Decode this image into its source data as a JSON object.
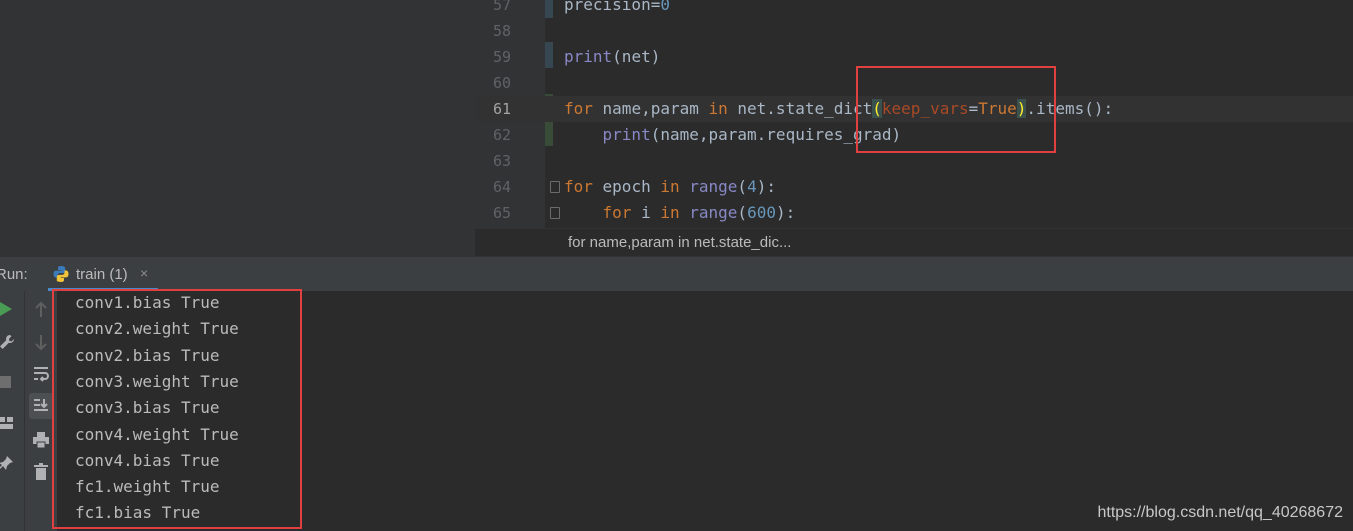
{
  "editor": {
    "lines": [
      {
        "number": "57",
        "tokens": [
          {
            "t": "precision"
          },
          {
            "t": "=",
            "c": "plain"
          },
          {
            "t": "0",
            "c": "num"
          }
        ]
      },
      {
        "number": "58",
        "tokens": []
      },
      {
        "number": "59",
        "tokens": [
          {
            "t": "print",
            "c": "bi"
          },
          {
            "t": "(net)"
          }
        ]
      },
      {
        "number": "60",
        "tokens": []
      },
      {
        "number": "61",
        "tokens": [
          {
            "t": "for",
            "c": "kw"
          },
          {
            "t": " name,param "
          },
          {
            "t": "in",
            "c": "kw"
          },
          {
            "t": " net.state_dict"
          },
          {
            "t": "(",
            "c": "paren-match"
          },
          {
            "t": "keep_vars",
            "c": "param"
          },
          {
            "t": "="
          },
          {
            "t": "True",
            "c": "kw"
          },
          {
            "t": ")",
            "c": "paren-match"
          },
          {
            "t": ".items():"
          }
        ]
      },
      {
        "number": "62",
        "tokens": [
          {
            "t": "    "
          },
          {
            "t": "print",
            "c": "bi"
          },
          {
            "t": "(name,param.requires_grad)"
          }
        ]
      },
      {
        "number": "63",
        "tokens": []
      },
      {
        "number": "64",
        "tokens": [
          {
            "t": "for",
            "c": "kw"
          },
          {
            "t": " epoch "
          },
          {
            "t": "in",
            "c": "kw"
          },
          {
            "t": " "
          },
          {
            "t": "range",
            "c": "bi"
          },
          {
            "t": "("
          },
          {
            "t": "4",
            "c": "num"
          },
          {
            "t": "):"
          }
        ]
      },
      {
        "number": "65",
        "tokens": [
          {
            "t": "    "
          },
          {
            "t": "for",
            "c": "kw"
          },
          {
            "t": " i "
          },
          {
            "t": "in",
            "c": "kw"
          },
          {
            "t": " "
          },
          {
            "t": "range",
            "c": "bi"
          },
          {
            "t": "("
          },
          {
            "t": "600",
            "c": "num"
          },
          {
            "t": "):"
          }
        ]
      }
    ],
    "breadcrumb": "for name,param in net.state_dic..."
  },
  "run": {
    "label": "Run:",
    "tab_label": "train (1)",
    "tab_close": "×",
    "output_lines": [
      "conv1.bias True",
      "conv2.weight True",
      "conv2.bias True",
      "conv3.weight True",
      "conv3.bias True",
      "conv4.weight True",
      "conv4.bias True",
      "fc1.weight True",
      "fc1.bias True"
    ]
  },
  "icons": {
    "outer_toolbar": [
      "run-icon",
      "wrench-icon",
      "stop-icon",
      "layout-icon",
      "pin-icon"
    ],
    "inner_toolbar": [
      "arrow-up-icon",
      "arrow-down-icon",
      "soft-wrap-icon",
      "scroll-to-end-icon",
      "print-icon",
      "trash-icon"
    ]
  },
  "watermark": "https://blog.csdn.net/qq_40268672",
  "colors": {
    "highlight_box": "#e0403f",
    "keyword": "#cc7832",
    "builtin": "#8888c6",
    "number": "#6897bb",
    "run_green": "#499c54"
  }
}
